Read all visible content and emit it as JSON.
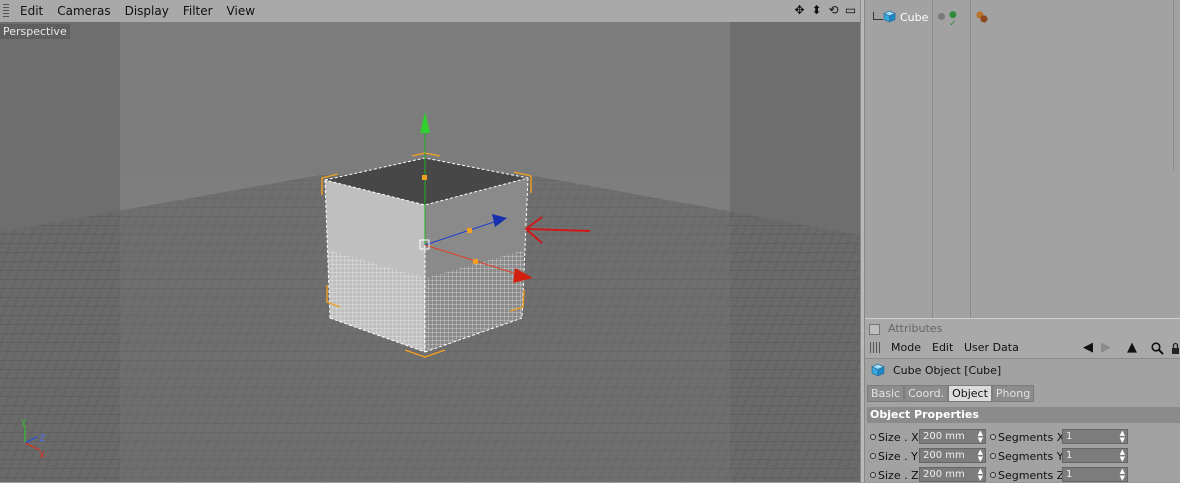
{
  "viewport": {
    "menu": [
      "Edit",
      "Cameras",
      "Display",
      "Filter",
      "View"
    ],
    "nav_icons": [
      "move-view-icon",
      "dolly-view-icon",
      "rotate-view-icon",
      "maximize-view-icon"
    ],
    "camera_label": "Perspective",
    "axis_labels": {
      "y": "Y",
      "z": "Z",
      "x": "X"
    }
  },
  "object_manager": {
    "objects": [
      {
        "name": "Cube",
        "icon": "cube-icon",
        "tag_icon": "material-tag-icon"
      }
    ]
  },
  "attributes": {
    "title": "Attributes",
    "menu": [
      "Mode",
      "Edit",
      "User Data"
    ],
    "nav_icons": [
      "back-icon",
      "forward-icon",
      "up-icon",
      "search-icon",
      "lock-icon"
    ],
    "object_header": "Cube Object [Cube]",
    "tabs": [
      "Basic",
      "Coord.",
      "Object",
      "Phong"
    ],
    "active_tab": "Object",
    "section_title": "Object Properties",
    "properties": [
      {
        "label": "Size . X",
        "value": "200 mm",
        "seg_label": "Segments X",
        "seg_value": "1"
      },
      {
        "label": "Size . Y",
        "value": "200 mm",
        "seg_label": "Segments Y",
        "seg_value": "1"
      },
      {
        "label": "Size . Z",
        "value": "200 mm",
        "seg_label": "Segments Z",
        "seg_value": "1"
      }
    ]
  },
  "colors": {
    "selection": "#f0a020",
    "axis_x": "#e03020",
    "axis_y": "#30c030",
    "axis_z": "#2040d0",
    "annotation_arrow": "#d01818"
  }
}
